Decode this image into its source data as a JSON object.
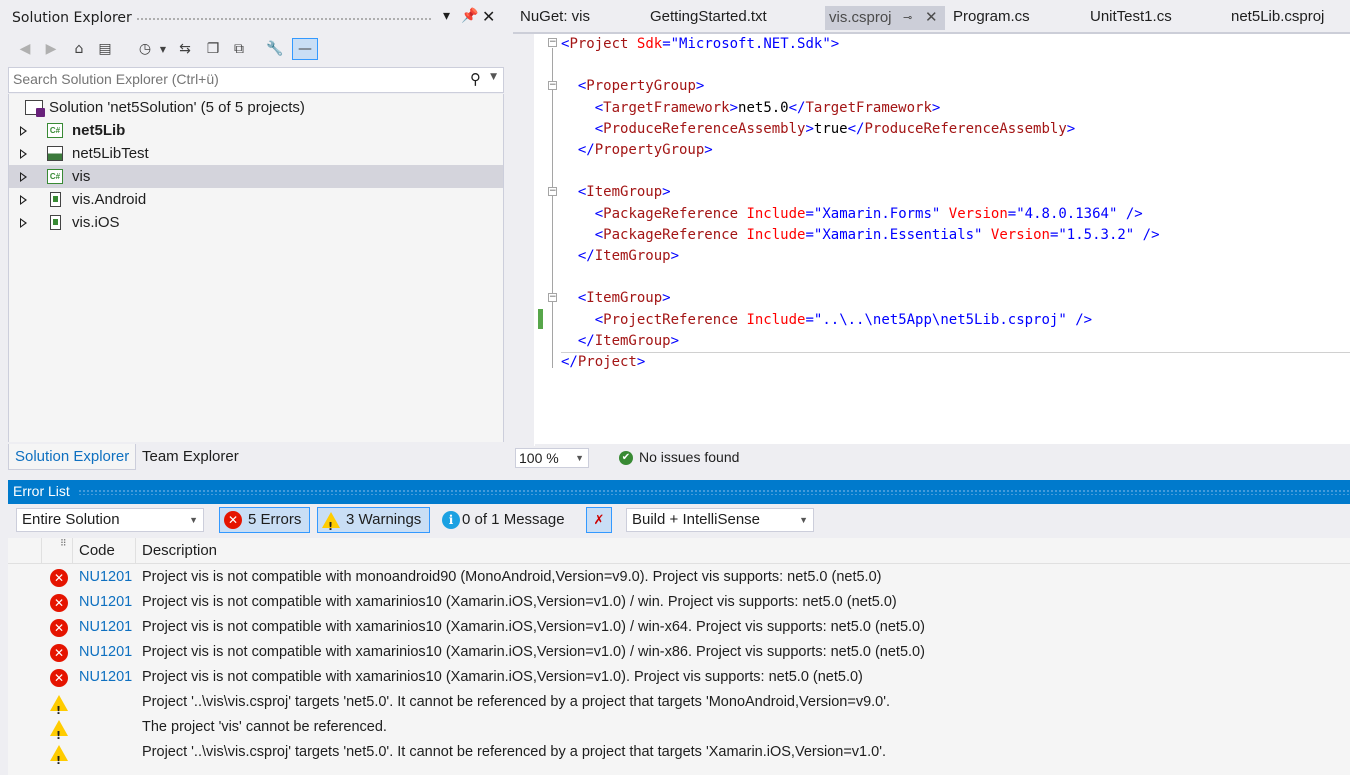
{
  "solution_explorer": {
    "title": "Solution Explorer",
    "search_placeholder": "Search Solution Explorer (Ctrl+ü)",
    "tree": [
      {
        "label": "Solution 'net5Solution' (5 of 5 projects)",
        "icon": "solution-icon"
      },
      {
        "label": "net5Lib",
        "icon": "csharp-project-icon",
        "bold": true
      },
      {
        "label": "net5LibTest",
        "icon": "test-project-icon"
      },
      {
        "label": "vis",
        "icon": "csharp-project-icon",
        "selected": true
      },
      {
        "label": "vis.Android",
        "icon": "android-project-icon"
      },
      {
        "label": "vis.iOS",
        "icon": "ios-project-icon"
      }
    ],
    "tabs": [
      {
        "label": "Solution Explorer",
        "active": true
      },
      {
        "label": "Team Explorer",
        "active": false
      }
    ]
  },
  "editor": {
    "tabs": [
      {
        "label": "NuGet: vis"
      },
      {
        "label": "GettingStarted.txt"
      },
      {
        "label": "vis.csproj",
        "active": true
      },
      {
        "label": "Program.cs"
      },
      {
        "label": "UnitTest1.cs"
      },
      {
        "label": "net5Lib.csproj"
      }
    ],
    "code": [
      "<Project Sdk=\"Microsoft.NET.Sdk\">",
      "",
      "  <PropertyGroup>",
      "    <TargetFramework>net5.0</TargetFramework>",
      "    <ProduceReferenceAssembly>true</ProduceReferenceAssembly>",
      "  </PropertyGroup>",
      "",
      "  <ItemGroup>",
      "    <PackageReference Include=\"Xamarin.Forms\" Version=\"4.8.0.1364\" />",
      "    <PackageReference Include=\"Xamarin.Essentials\" Version=\"1.5.3.2\" />",
      "  </ItemGroup>",
      "",
      "  <ItemGroup>",
      "    <ProjectReference Include=\"..\\..\\net5App\\net5Lib.csproj\" />",
      "  </ItemGroup>",
      "</Project>"
    ],
    "zoom": "100 %",
    "status": "No issues found"
  },
  "error_list": {
    "title": "Error List",
    "scope": "Entire Solution",
    "errors_label": "5 Errors",
    "warnings_label": "3 Warnings",
    "messages_label": "0 of 1 Message",
    "source_filter": "Build + IntelliSense",
    "columns": {
      "code": "Code",
      "description": "Description"
    },
    "rows": [
      {
        "type": "error",
        "code": "NU1201",
        "description": "Project vis is not compatible with monoandroid90 (MonoAndroid,Version=v9.0). Project vis supports: net5.0 (net5.0)"
      },
      {
        "type": "error",
        "code": "NU1201",
        "description": "Project vis is not compatible with xamarinios10 (Xamarin.iOS,Version=v1.0) / win. Project vis supports: net5.0 (net5.0)"
      },
      {
        "type": "error",
        "code": "NU1201",
        "description": "Project vis is not compatible with xamarinios10 (Xamarin.iOS,Version=v1.0) / win-x64. Project vis supports: net5.0 (net5.0)"
      },
      {
        "type": "error",
        "code": "NU1201",
        "description": "Project vis is not compatible with xamarinios10 (Xamarin.iOS,Version=v1.0) / win-x86. Project vis supports: net5.0 (net5.0)"
      },
      {
        "type": "error",
        "code": "NU1201",
        "description": "Project vis is not compatible with xamarinios10 (Xamarin.iOS,Version=v1.0). Project vis supports: net5.0 (net5.0)"
      },
      {
        "type": "warning",
        "code": "",
        "description": "Project '..\\vis\\vis.csproj' targets 'net5.0'. It cannot be referenced by a project that targets 'MonoAndroid,Version=v9.0'."
      },
      {
        "type": "warning",
        "code": "",
        "description": "The project 'vis' cannot be referenced."
      },
      {
        "type": "warning",
        "code": "",
        "description": "Project '..\\vis\\vis.csproj' targets 'net5.0'. It cannot be referenced by a project that targets 'Xamarin.iOS,Version=v1.0'."
      }
    ]
  },
  "colors": {
    "accent": "#007acc",
    "error": "#e51400",
    "warning": "#ffcc00",
    "info": "#1ba1e2",
    "xml_bracket": "#0000ff",
    "xml_element": "#a31515",
    "xml_attribute": "#ff0000"
  }
}
